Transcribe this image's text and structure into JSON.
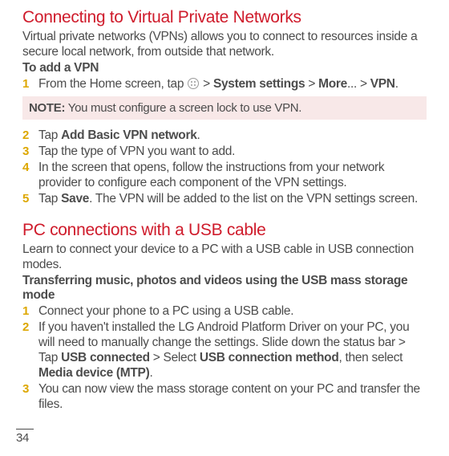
{
  "section1": {
    "heading": "Connecting to Virtual Private Networks",
    "intro": "Virtual private networks (VPNs) allows you to connect to resources inside a secure local network, from outside that network.",
    "subhead": "To add a VPN",
    "step1": {
      "prefix": "From the Home screen, tap ",
      "gt1": " > ",
      "bold1": "System settings",
      "gt2": " > ",
      "bold2": "More",
      "ellipsis": "... > ",
      "bold3": "VPN",
      "period": "."
    },
    "note": {
      "label": "NOTE:",
      "text": " You must configure a screen lock to use VPN."
    },
    "step2": {
      "prefix": "Tap ",
      "bold": "Add Basic VPN network",
      "suffix": "."
    },
    "step3": "Tap the type of VPN you want to add.",
    "step4": "In the screen that opens, follow the instructions from your network provider to configure each component of the VPN settings.",
    "step5": {
      "prefix": "Tap ",
      "bold": "Save",
      "suffix": ". The VPN will be added to the list on the VPN settings screen."
    }
  },
  "section2": {
    "heading": "PC connections with a USB cable",
    "intro": "Learn to connect your device to a PC with a USB cable in USB connection modes.",
    "subhead": "Transferring music, photos and videos using the USB mass storage mode",
    "step1": "Connect your phone to a PC using a USB cable.",
    "step2": {
      "p1": "If you haven't installed the LG Android Platform Driver on your PC, you will need to manually change the settings. Slide down the status bar > Tap ",
      "b1": "USB connected",
      "p2": " > Select ",
      "b2": "USB connection method",
      "p3": ", then select ",
      "b3": "Media device (MTP)",
      "p4": "."
    },
    "step3": "You can now view the mass storage content on your PC and transfer the files."
  },
  "nums": {
    "n1": "1",
    "n2": "2",
    "n3": "3",
    "n4": "4",
    "n5": "5"
  },
  "pageNumber": "34"
}
